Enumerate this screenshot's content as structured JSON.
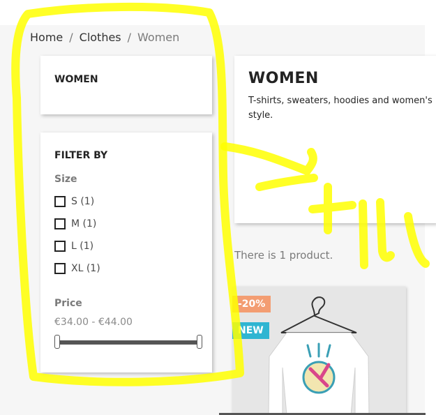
{
  "breadcrumb": {
    "items": [
      "Home",
      "Clothes",
      "Women"
    ],
    "separator": "/"
  },
  "sidebar": {
    "category_title": "WOMEN",
    "filter_title": "FILTER BY",
    "size_facet": {
      "title": "Size",
      "options": [
        {
          "label": "S (1)",
          "checked": false
        },
        {
          "label": "M (1)",
          "checked": false
        },
        {
          "label": "L (1)",
          "checked": false
        },
        {
          "label": "XL (1)",
          "checked": false
        }
      ]
    },
    "price_facet": {
      "title": "Price",
      "range": "€34.00 - €44.00"
    }
  },
  "category_header": {
    "title": "WOMEN",
    "description": "T-shirts, sweaters, hoodies and women's style."
  },
  "product_count": "There is 1 product.",
  "product": {
    "badges": {
      "discount": "-20%",
      "new": "NEW"
    }
  },
  "icons": {
    "checkbox": "checkbox-icon",
    "hanger": "hanger-icon"
  },
  "colors": {
    "discount_badge": "#f39d72",
    "new_badge": "#2fb5d2",
    "annotation": "#ffff00"
  }
}
